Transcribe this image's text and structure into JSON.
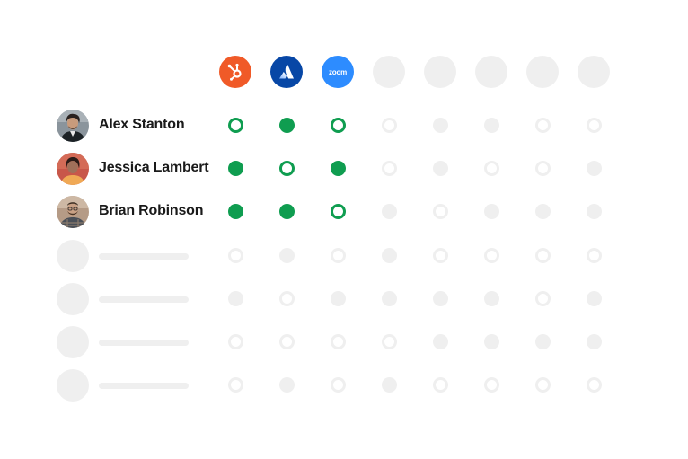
{
  "colors": {
    "active": "#0f9d50",
    "inactive": "#efefef",
    "hubspot": "#f05a28",
    "atlassian": "#0747a6",
    "zoom": "#2d8cff"
  },
  "apps": [
    {
      "name": "HubSpot",
      "icon": "hubspot-icon"
    },
    {
      "name": "Atlassian",
      "icon": "atlassian-icon"
    },
    {
      "name": "Zoom",
      "icon": "zoom-icon",
      "label": "zoom"
    },
    {
      "name": "",
      "icon": "placeholder"
    },
    {
      "name": "",
      "icon": "placeholder"
    },
    {
      "name": "",
      "icon": "placeholder"
    },
    {
      "name": "",
      "icon": "placeholder"
    },
    {
      "name": "",
      "icon": "placeholder"
    }
  ],
  "users": [
    {
      "name": "Alex Stanton",
      "avatar": "avatar-alex",
      "access": [
        "open",
        "filled",
        "open",
        "ring",
        "fill",
        "fill",
        "ring",
        "ring"
      ]
    },
    {
      "name": "Jessica Lambert",
      "avatar": "avatar-jessica",
      "access": [
        "filled",
        "open",
        "filled",
        "ring",
        "fill",
        "ring",
        "ring",
        "fill"
      ]
    },
    {
      "name": "Brian Robinson",
      "avatar": "avatar-brian",
      "access": [
        "filled",
        "filled",
        "open",
        "fill",
        "ring",
        "fill",
        "fill",
        "fill"
      ]
    },
    {
      "name": "",
      "avatar": "placeholder",
      "access": [
        "ring",
        "fill",
        "ring",
        "fill",
        "ring",
        "ring",
        "ring",
        "ring"
      ]
    },
    {
      "name": "",
      "avatar": "placeholder",
      "access": [
        "fill",
        "ring",
        "fill",
        "fill",
        "fill",
        "fill",
        "ring",
        "fill"
      ]
    },
    {
      "name": "",
      "avatar": "placeholder",
      "access": [
        "ring",
        "ring",
        "ring",
        "ring",
        "fill",
        "fill",
        "fill",
        "fill"
      ]
    },
    {
      "name": "",
      "avatar": "placeholder",
      "access": [
        "ring",
        "fill",
        "ring",
        "fill",
        "ring",
        "ring",
        "ring",
        "ring"
      ]
    }
  ]
}
